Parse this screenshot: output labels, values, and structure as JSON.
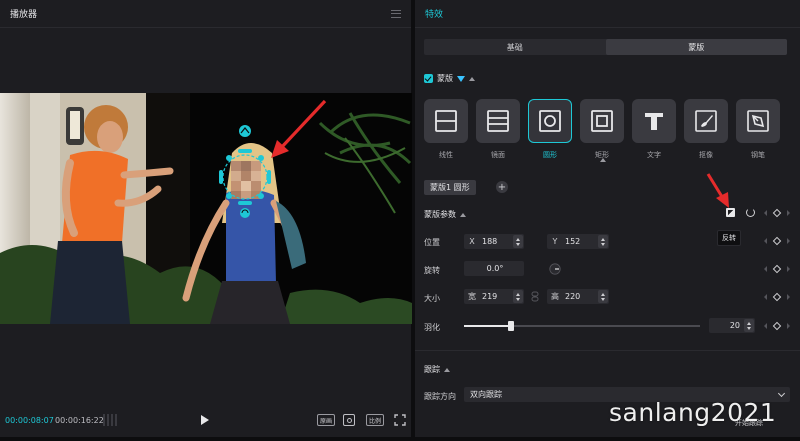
{
  "player": {
    "title": "播放器",
    "current_time": "00:00:08:07",
    "total_time": "00:00:16:22",
    "btn_quality": "原画",
    "btn_ratio": "比例"
  },
  "effects": {
    "title": "特效",
    "tabs": [
      {
        "label": "基础",
        "active": false
      },
      {
        "label": "蒙版",
        "active": true
      }
    ],
    "mask_section": {
      "label": "蒙版",
      "enabled": true
    },
    "mask_types": [
      {
        "label": "线性",
        "icon": "linear-mask-icon"
      },
      {
        "label": "镜面",
        "icon": "mirror-mask-icon"
      },
      {
        "label": "圆形",
        "icon": "circle-mask-icon",
        "selected": true
      },
      {
        "label": "矩形",
        "icon": "rect-mask-icon"
      },
      {
        "label": "文字",
        "icon": "text-mask-icon"
      },
      {
        "label": "抠像",
        "icon": "brush-mask-icon"
      },
      {
        "label": "钢笔",
        "icon": "pen-mask-icon"
      }
    ],
    "active_mask": "蒙版1 圆形",
    "params_label": "蒙版参数",
    "invert_tooltip": "反转",
    "position": {
      "label": "位置",
      "x_key": "X",
      "x": "188",
      "y_key": "Y",
      "y": "152"
    },
    "rotation": {
      "label": "旋转",
      "value": "0.0°"
    },
    "size": {
      "label": "大小",
      "w_key": "宽",
      "w": "219",
      "h_key": "高",
      "h": "220"
    },
    "feather": {
      "label": "羽化",
      "value": "20",
      "fraction": 0.2
    },
    "tracking": {
      "label": "跟踪",
      "direction_label": "跟踪方向",
      "direction_value": "双向跟踪",
      "start_label": "开始跟踪"
    }
  },
  "watermark": "sanlang2021",
  "colors": {
    "accent": "#1ec8d6",
    "panel": "#1d1d21",
    "arrow": "#e52b2b"
  }
}
